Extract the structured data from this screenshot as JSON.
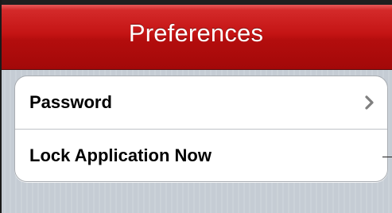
{
  "nav_bar": {
    "title": "Preferences"
  },
  "settings_list": {
    "rows": [
      {
        "label": "Password",
        "accessory": "chevron-right-icon"
      },
      {
        "label": "Lock Application Now",
        "accessory": ""
      }
    ]
  },
  "colors": {
    "nav_bar_red": "#c41414",
    "background_pinstripe": "#c5ccd4",
    "row_background": "#ffffff",
    "chevron": "#7f7f7f"
  }
}
